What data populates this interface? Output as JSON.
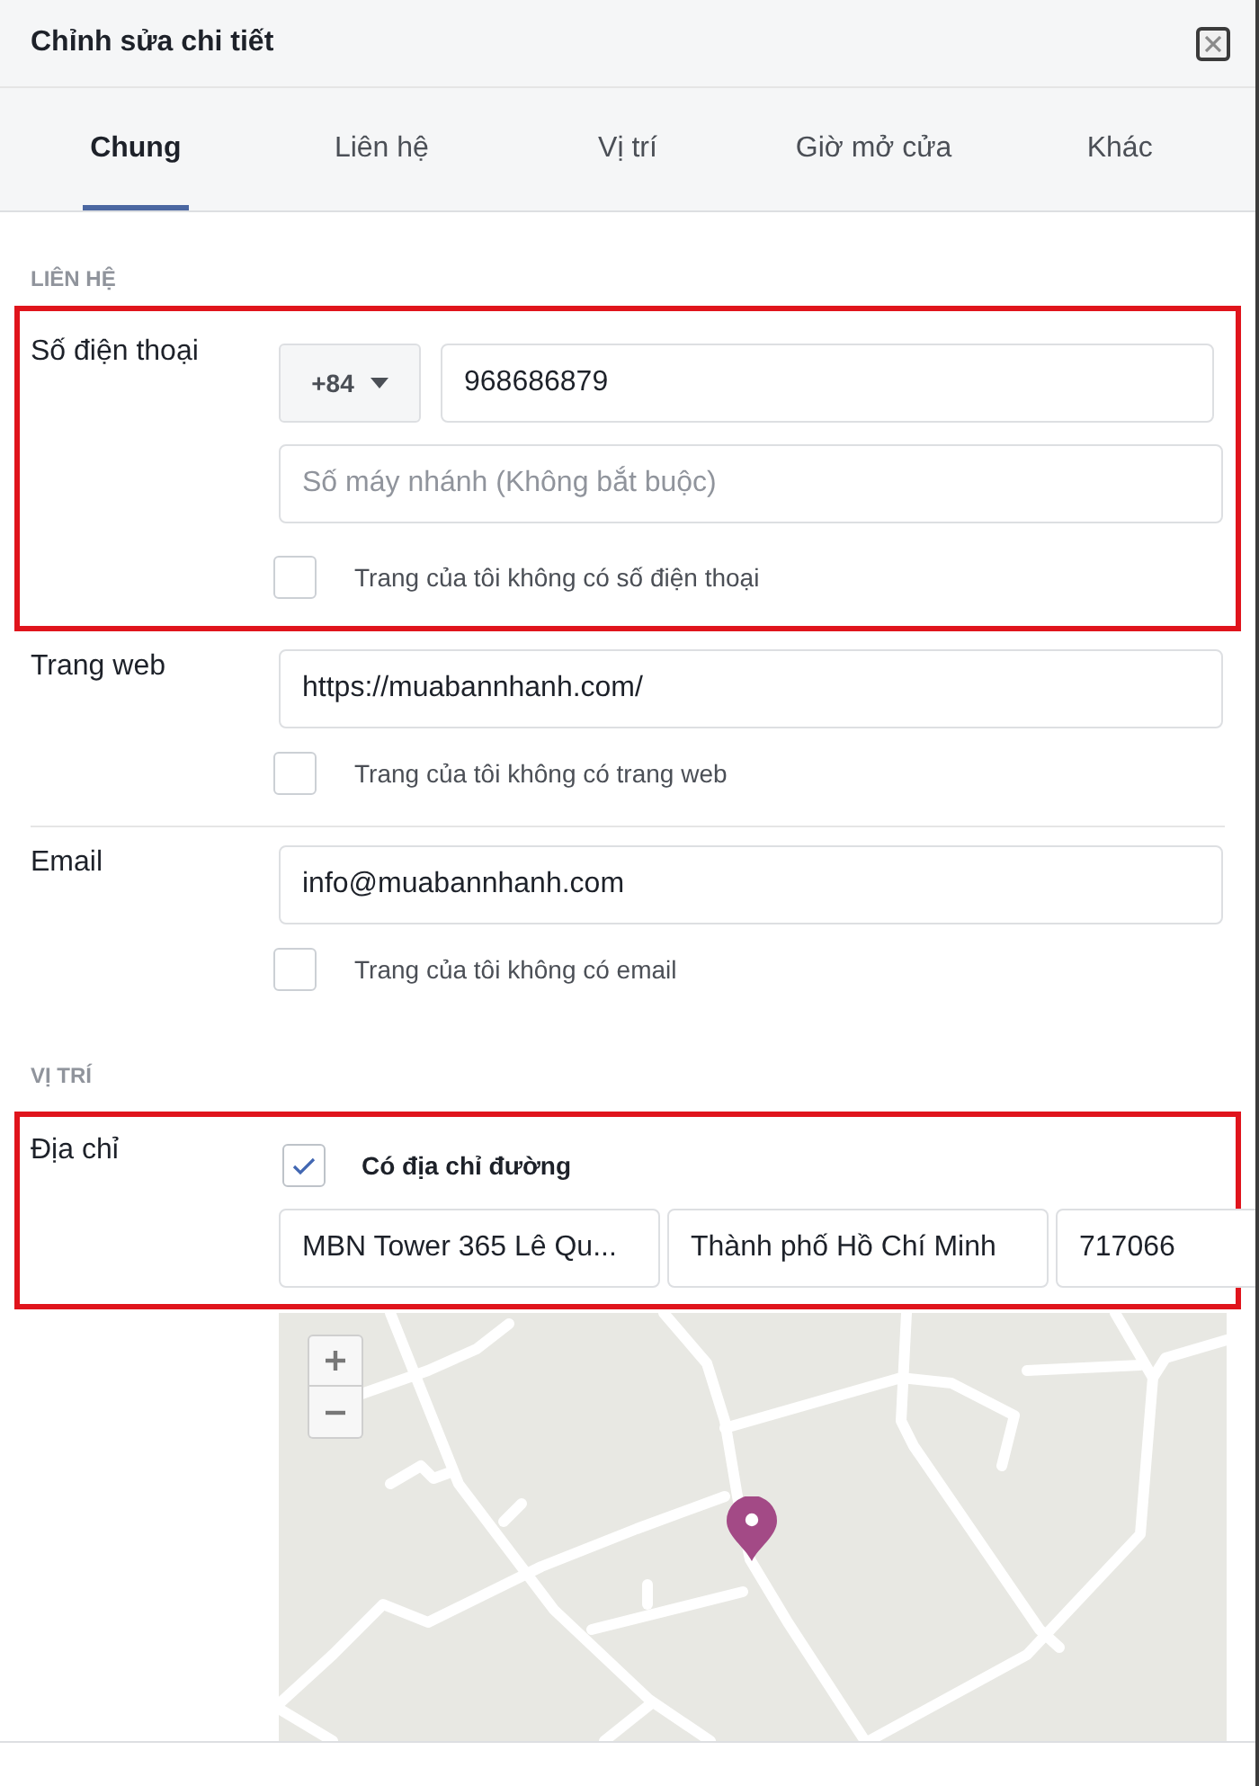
{
  "dialog": {
    "title": "Chỉnh sửa chi tiết"
  },
  "tabs": [
    {
      "label": "Chung",
      "selected": true
    },
    {
      "label": "Liên hệ",
      "selected": false
    },
    {
      "label": "Vị trí",
      "selected": false
    },
    {
      "label": "Giờ mở cửa",
      "selected": false
    },
    {
      "label": "Khác",
      "selected": false
    }
  ],
  "contact": {
    "heading": "LIÊN HỆ",
    "rows": [
      {
        "kind": "phone",
        "label": "Số điện thoại",
        "highlighted": true,
        "country_code": "+84",
        "value": "968686879",
        "extension": {
          "placeholder": "Số máy nhánh (Không bắt buộc)"
        },
        "checkbox": {
          "label": "Trang của tôi không có số điện thoại",
          "checked": false
        }
      },
      {
        "kind": "text",
        "label": "Trang web",
        "highlighted": false,
        "value": "https://muabannhanh.com/",
        "checkbox": {
          "label": "Trang của tôi không có trang web",
          "checked": false
        }
      },
      {
        "kind": "text",
        "label": "Email",
        "highlighted": false,
        "value": "info@muabannhanh.com",
        "checkbox": {
          "label": "Trang của tôi không có email",
          "checked": false
        }
      }
    ]
  },
  "location": {
    "heading": "VỊ TRÍ",
    "address": {
      "label": "Địa chỉ",
      "highlighted": true,
      "checkbox": {
        "label": "Có địa chỉ đường",
        "checked": true
      },
      "street": "MBN Tower 365 Lê Qu...",
      "city": "Thành phố Hồ Chí Minh",
      "postal_code": "717066"
    }
  }
}
